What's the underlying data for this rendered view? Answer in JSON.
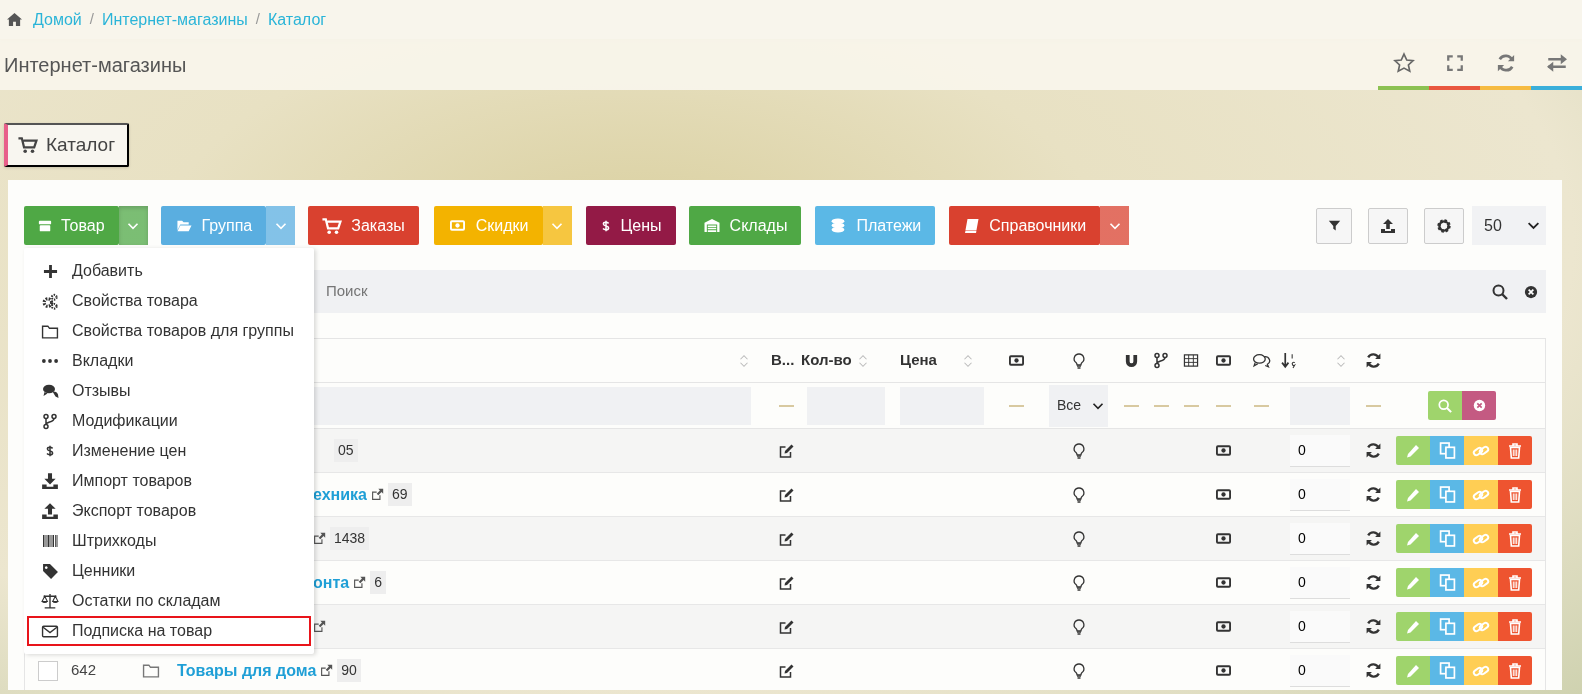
{
  "breadcrumb": [
    {
      "label": "Домой"
    },
    {
      "separator": "/",
      "label": "Интернет-магазины"
    },
    {
      "separator": "/",
      "label": "Каталог"
    }
  ],
  "page_title": "Интернет-магазины",
  "header_actions": [
    {
      "color": "#8cc152"
    },
    {
      "color": "#e9573f"
    },
    {
      "color": "#f6bb42"
    },
    {
      "color": "#3bafda"
    }
  ],
  "section_tab": "Каталог",
  "toolbar": [
    {
      "label": "Товар",
      "color": "#4fa845",
      "expanded": true
    },
    {
      "label": "Группа",
      "color": "#5aaee0",
      "expanded": false
    },
    {
      "label": "Заказы",
      "color": "#d9412f"
    },
    {
      "label": "Скидки",
      "color": "#f3b300",
      "expanded": false
    },
    {
      "label": "Цены",
      "color": "#931a46"
    },
    {
      "label": "Склады",
      "color": "#4fa845"
    },
    {
      "label": "Платежи",
      "color": "#5bb8e6"
    },
    {
      "label": "Справочники",
      "color": "#d9412f",
      "expanded": false
    }
  ],
  "page_size": "50",
  "product_menu": [
    {
      "label": "Добавить",
      "outlined": false
    },
    {
      "label": "Свойства товара",
      "outlined": false
    },
    {
      "label": "Свойства товаров для группы",
      "outlined": false
    },
    {
      "label": "Вкладки",
      "outlined": false
    },
    {
      "label": "Отзывы",
      "outlined": false
    },
    {
      "label": "Модификации",
      "outlined": false
    },
    {
      "label": "Изменение цен",
      "outlined": false
    },
    {
      "label": "Импорт товаров",
      "outlined": false
    },
    {
      "label": "Экспорт товаров",
      "outlined": false
    },
    {
      "label": "Штрихкоды",
      "outlined": false
    },
    {
      "label": "Ценники",
      "outlined": false
    },
    {
      "label": "Остатки по складам",
      "outlined": false
    },
    {
      "label": "Подписка на товар",
      "outlined": true
    }
  ],
  "search": {
    "placeholder": "Поиск"
  },
  "table": {
    "columns": [
      "В...",
      "Кол-во",
      "Цена"
    ],
    "status_filter": "Все",
    "rows": [
      {
        "count": "05",
        "link_icon": false,
        "qty": "0"
      },
      {
        "name": "ехника",
        "count": "69",
        "link_icon": true,
        "qty": "0"
      },
      {
        "count": "1438",
        "link_icon": true,
        "qty": "0"
      },
      {
        "name": "онта",
        "count": "6",
        "link_icon": true,
        "qty": "0"
      },
      {
        "link_icon": true,
        "qty": "0"
      },
      {
        "id": "642",
        "name": "Товары для дома",
        "count": "90",
        "link_icon": true,
        "qty": "0"
      }
    ]
  }
}
